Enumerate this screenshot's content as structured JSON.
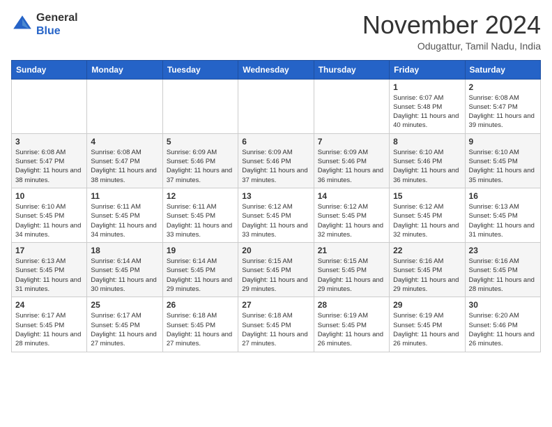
{
  "header": {
    "logo_line1": "General",
    "logo_line2": "Blue",
    "month": "November 2024",
    "location": "Odugattur, Tamil Nadu, India"
  },
  "weekdays": [
    "Sunday",
    "Monday",
    "Tuesday",
    "Wednesday",
    "Thursday",
    "Friday",
    "Saturday"
  ],
  "weeks": [
    [
      {
        "day": "",
        "info": ""
      },
      {
        "day": "",
        "info": ""
      },
      {
        "day": "",
        "info": ""
      },
      {
        "day": "",
        "info": ""
      },
      {
        "day": "",
        "info": ""
      },
      {
        "day": "1",
        "info": "Sunrise: 6:07 AM\nSunset: 5:48 PM\nDaylight: 11 hours and 40 minutes."
      },
      {
        "day": "2",
        "info": "Sunrise: 6:08 AM\nSunset: 5:47 PM\nDaylight: 11 hours and 39 minutes."
      }
    ],
    [
      {
        "day": "3",
        "info": "Sunrise: 6:08 AM\nSunset: 5:47 PM\nDaylight: 11 hours and 38 minutes."
      },
      {
        "day": "4",
        "info": "Sunrise: 6:08 AM\nSunset: 5:47 PM\nDaylight: 11 hours and 38 minutes."
      },
      {
        "day": "5",
        "info": "Sunrise: 6:09 AM\nSunset: 5:46 PM\nDaylight: 11 hours and 37 minutes."
      },
      {
        "day": "6",
        "info": "Sunrise: 6:09 AM\nSunset: 5:46 PM\nDaylight: 11 hours and 37 minutes."
      },
      {
        "day": "7",
        "info": "Sunrise: 6:09 AM\nSunset: 5:46 PM\nDaylight: 11 hours and 36 minutes."
      },
      {
        "day": "8",
        "info": "Sunrise: 6:10 AM\nSunset: 5:46 PM\nDaylight: 11 hours and 36 minutes."
      },
      {
        "day": "9",
        "info": "Sunrise: 6:10 AM\nSunset: 5:45 PM\nDaylight: 11 hours and 35 minutes."
      }
    ],
    [
      {
        "day": "10",
        "info": "Sunrise: 6:10 AM\nSunset: 5:45 PM\nDaylight: 11 hours and 34 minutes."
      },
      {
        "day": "11",
        "info": "Sunrise: 6:11 AM\nSunset: 5:45 PM\nDaylight: 11 hours and 34 minutes."
      },
      {
        "day": "12",
        "info": "Sunrise: 6:11 AM\nSunset: 5:45 PM\nDaylight: 11 hours and 33 minutes."
      },
      {
        "day": "13",
        "info": "Sunrise: 6:12 AM\nSunset: 5:45 PM\nDaylight: 11 hours and 33 minutes."
      },
      {
        "day": "14",
        "info": "Sunrise: 6:12 AM\nSunset: 5:45 PM\nDaylight: 11 hours and 32 minutes."
      },
      {
        "day": "15",
        "info": "Sunrise: 6:12 AM\nSunset: 5:45 PM\nDaylight: 11 hours and 32 minutes."
      },
      {
        "day": "16",
        "info": "Sunrise: 6:13 AM\nSunset: 5:45 PM\nDaylight: 11 hours and 31 minutes."
      }
    ],
    [
      {
        "day": "17",
        "info": "Sunrise: 6:13 AM\nSunset: 5:45 PM\nDaylight: 11 hours and 31 minutes."
      },
      {
        "day": "18",
        "info": "Sunrise: 6:14 AM\nSunset: 5:45 PM\nDaylight: 11 hours and 30 minutes."
      },
      {
        "day": "19",
        "info": "Sunrise: 6:14 AM\nSunset: 5:45 PM\nDaylight: 11 hours and 29 minutes."
      },
      {
        "day": "20",
        "info": "Sunrise: 6:15 AM\nSunset: 5:45 PM\nDaylight: 11 hours and 29 minutes."
      },
      {
        "day": "21",
        "info": "Sunrise: 6:15 AM\nSunset: 5:45 PM\nDaylight: 11 hours and 29 minutes."
      },
      {
        "day": "22",
        "info": "Sunrise: 6:16 AM\nSunset: 5:45 PM\nDaylight: 11 hours and 29 minutes."
      },
      {
        "day": "23",
        "info": "Sunrise: 6:16 AM\nSunset: 5:45 PM\nDaylight: 11 hours and 28 minutes."
      }
    ],
    [
      {
        "day": "24",
        "info": "Sunrise: 6:17 AM\nSunset: 5:45 PM\nDaylight: 11 hours and 28 minutes."
      },
      {
        "day": "25",
        "info": "Sunrise: 6:17 AM\nSunset: 5:45 PM\nDaylight: 11 hours and 27 minutes."
      },
      {
        "day": "26",
        "info": "Sunrise: 6:18 AM\nSunset: 5:45 PM\nDaylight: 11 hours and 27 minutes."
      },
      {
        "day": "27",
        "info": "Sunrise: 6:18 AM\nSunset: 5:45 PM\nDaylight: 11 hours and 27 minutes."
      },
      {
        "day": "28",
        "info": "Sunrise: 6:19 AM\nSunset: 5:45 PM\nDaylight: 11 hours and 26 minutes."
      },
      {
        "day": "29",
        "info": "Sunrise: 6:19 AM\nSunset: 5:45 PM\nDaylight: 11 hours and 26 minutes."
      },
      {
        "day": "30",
        "info": "Sunrise: 6:20 AM\nSunset: 5:46 PM\nDaylight: 11 hours and 26 minutes."
      }
    ]
  ]
}
